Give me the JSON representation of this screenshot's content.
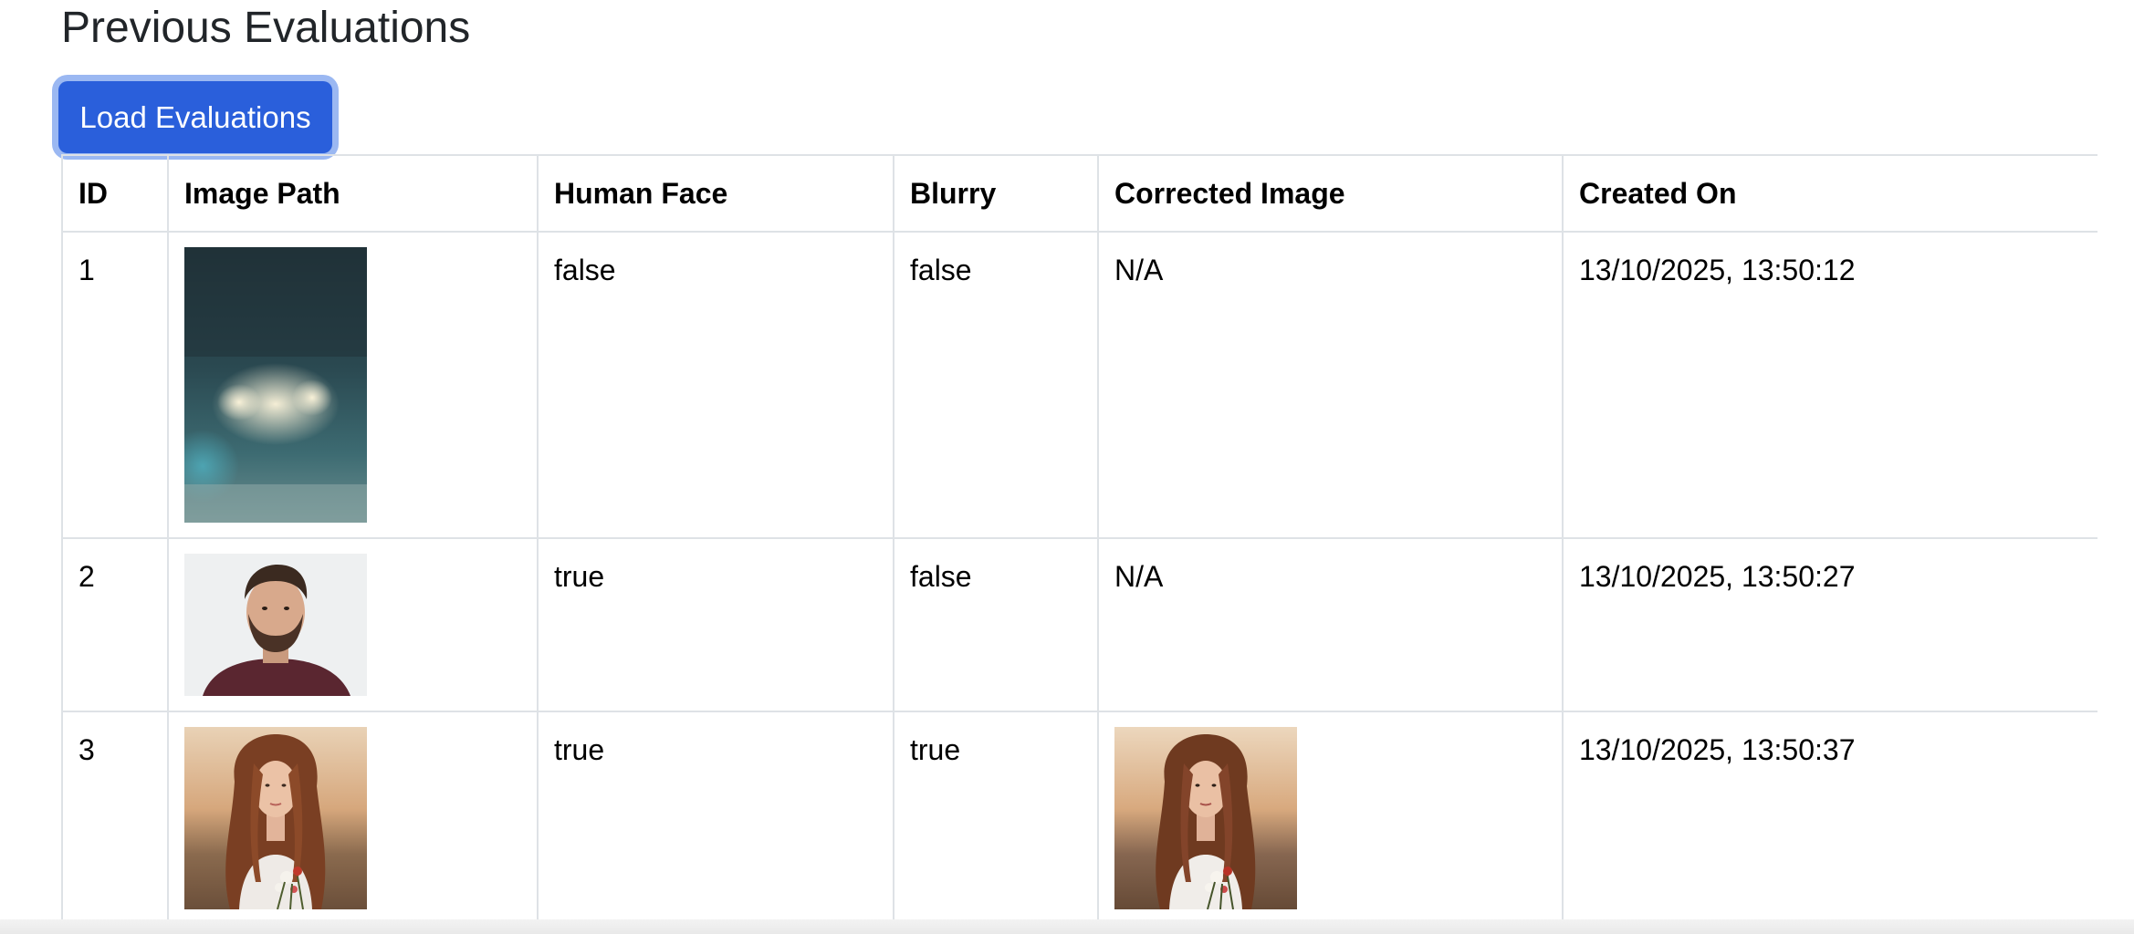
{
  "page": {
    "title": "Previous Evaluations",
    "load_button_label": "Load Evaluations"
  },
  "table": {
    "headers": {
      "id": "ID",
      "image_path": "Image Path",
      "human_face": "Human Face",
      "blurry": "Blurry",
      "corrected_image": "Corrected Image",
      "created_on": "Created On"
    },
    "rows": [
      {
        "id": "1",
        "image_path_thumbnail": "blurry-bokeh-lights-image",
        "human_face": "false",
        "blurry": "false",
        "corrected_image": "N/A",
        "created_on": "13/10/2025, 13:50:12"
      },
      {
        "id": "2",
        "image_path_thumbnail": "bearded-man-portrait-image",
        "human_face": "true",
        "blurry": "false",
        "corrected_image": "N/A",
        "created_on": "13/10/2025, 13:50:27"
      },
      {
        "id": "3",
        "image_path_thumbnail": "woman-with-flowers-portrait-image",
        "human_face": "true",
        "blurry": "true",
        "corrected_image_thumbnail": "woman-with-flowers-corrected-image",
        "created_on": "13/10/2025, 13:50:37"
      }
    ]
  },
  "colors": {
    "button_bg": "#2a5fdb",
    "button_focus_ring": "#9bb8f2",
    "table_border": "#dee2e6",
    "title_text": "#212529"
  }
}
